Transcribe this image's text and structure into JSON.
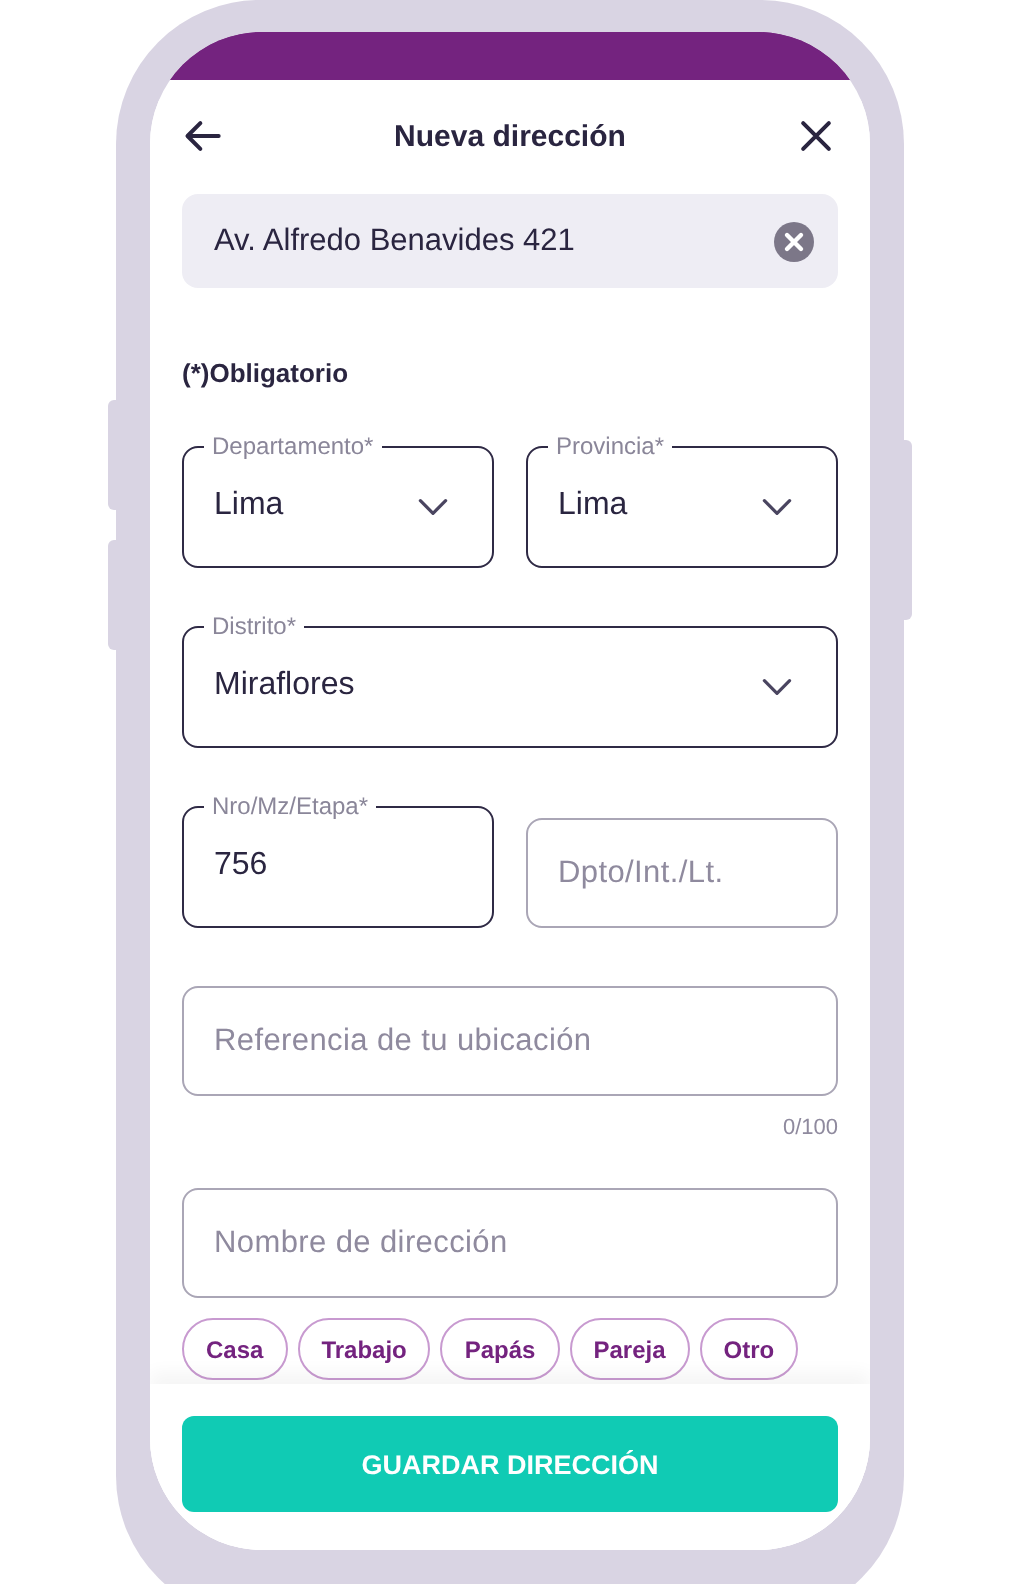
{
  "header": {
    "title": "Nueva dirección"
  },
  "search": {
    "value": "Av. Alfredo Benavides 421"
  },
  "required_note": "(*)Obligatorio",
  "field_rows": [
    [
      {
        "kind": "select",
        "label": "Departamento*",
        "value": "Lima"
      },
      {
        "kind": "select",
        "label": "Provincia*",
        "value": "Lima"
      }
    ],
    [
      {
        "kind": "select",
        "label": "Distrito*",
        "value": "Miraflores"
      }
    ],
    [
      {
        "kind": "input",
        "label": "Nro/Mz/Etapa*",
        "value": "756"
      },
      {
        "kind": "input",
        "placeholder": "Dpto/Int./Lt."
      }
    ]
  ],
  "reference": {
    "placeholder": "Referencia de tu ubicación",
    "counter": "0/100"
  },
  "address_name": {
    "placeholder": "Nombre de dirección"
  },
  "chips": [
    {
      "label": "Casa",
      "selected": false
    },
    {
      "label": "Trabajo",
      "selected": false
    },
    {
      "label": "Papás",
      "selected": false
    },
    {
      "label": "Pareja",
      "selected": false
    },
    {
      "label": "Otro",
      "selected": false
    }
  ],
  "save_button": "GUARDAR DIRECCIÓN"
}
